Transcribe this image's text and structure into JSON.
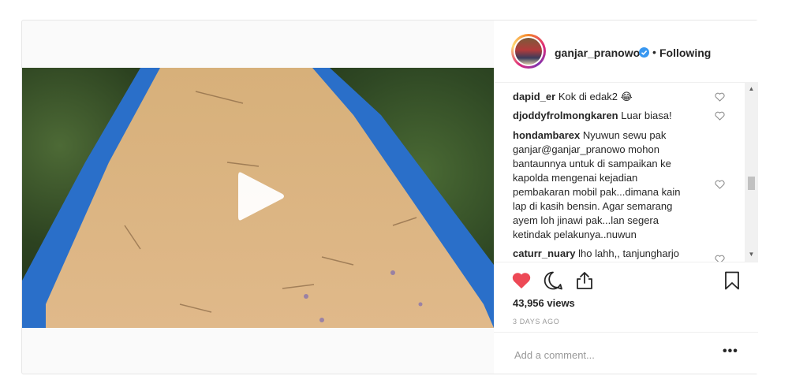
{
  "header": {
    "username": "ganjar_pranowo",
    "separator": "•",
    "follow_label": "Following"
  },
  "comments": [
    {
      "user": "dapid_er",
      "text": "Kok di edak2 😂"
    },
    {
      "user": "djoddyfrolmongkaren",
      "text": "Luar biasa!"
    },
    {
      "user": "hondambarex",
      "lines": [
        "Nyuwun sewu pak",
        "ganjar@ganjar_pranowo mohon",
        "bantaunnya untuk di sampaikan ke",
        "kapolda mengenai kejadian",
        "pembakaran mobil pak...dimana kain",
        "lap di kasih bensin. Agar semarang",
        "ayem loh jinawi pak...lan segera",
        "ketindak pelakunya..nuwun"
      ]
    },
    {
      "user": "caturr_nuary",
      "text": "lho lahh,, tanjungharjo"
    }
  ],
  "post": {
    "views": "43,956 views",
    "date": "3 DAYS AGO"
  },
  "add_comment": {
    "placeholder": "Add a comment...",
    "more": "•••"
  },
  "colors": {
    "like_red": "#ed4956",
    "verified_blue": "#3897f0",
    "tarp_blue": "#2a6fc9",
    "grain": "#d8b47e"
  },
  "icons": [
    "verified-icon",
    "heart-icon",
    "comment-icon",
    "share-icon",
    "bookmark-icon",
    "play-icon"
  ]
}
